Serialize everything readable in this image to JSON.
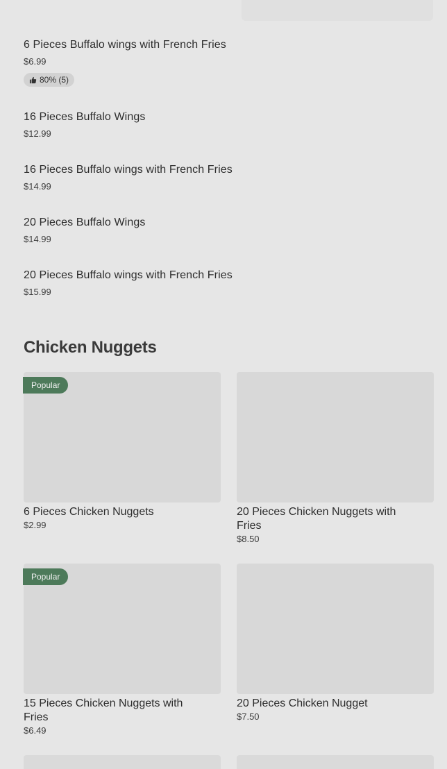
{
  "top_items": [
    {
      "title": "6 Pieces Buffalo wings with French Fries",
      "price": "$6.99",
      "rating": "80% (5)"
    },
    {
      "title": "16 Pieces Buffalo Wings",
      "price": "$12.99"
    },
    {
      "title": "16 Pieces Buffalo wings with French Fries",
      "price": "$14.99"
    },
    {
      "title": "20 Pieces Buffalo Wings",
      "price": "$14.99"
    },
    {
      "title": "20 Pieces Buffalo wings with French Fries",
      "price": "$15.99"
    }
  ],
  "section": {
    "title": "Chicken Nuggets"
  },
  "cards": [
    {
      "name": "6 Pieces Chicken Nuggets",
      "price": "$2.99",
      "badge": "Popular"
    },
    {
      "name": "20 Pieces Chicken Nuggets with Fries",
      "price": "$8.50"
    },
    {
      "name": "15 Pieces Chicken Nuggets with Fries",
      "price": "$6.49",
      "badge": "Popular"
    },
    {
      "name": "20 Pieces Chicken Nugget",
      "price": "$7.50"
    }
  ],
  "icons": {
    "rating": "thumbs-up-icon"
  },
  "colors": {
    "badge_bg": "#4d7a5a",
    "background": "#e6e6e6"
  }
}
